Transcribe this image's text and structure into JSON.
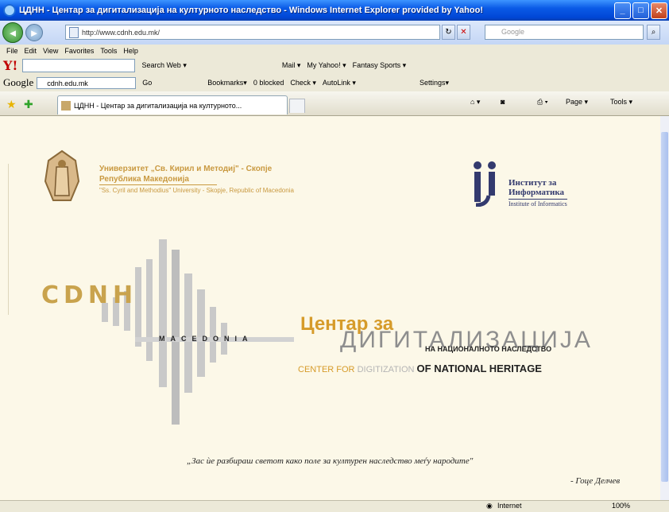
{
  "window": {
    "title": "ЦДНН - Центар за дигитализација на културното наследство - Windows Internet Explorer provided by Yahoo!"
  },
  "address": {
    "url": "http://www.cdnh.edu.mk/"
  },
  "search": {
    "placeholder": "Google"
  },
  "menu": [
    "File",
    "Edit",
    "View",
    "Favorites",
    "Tools",
    "Help"
  ],
  "yahoo_toolbar": {
    "logo": "Y!",
    "search_web": "Search Web ▾",
    "items": [
      "Mail ▾",
      "My Yahoo! ▾",
      "Fantasy Sports ▾"
    ]
  },
  "google_toolbar": {
    "logo": "Google",
    "query": "cdnh.edu.mk",
    "go": "Go",
    "items": [
      "Bookmarks▾",
      "0 blocked",
      "Check ▾",
      "AutoLink ▾",
      "Settings▾"
    ]
  },
  "tab": {
    "title": "ЦДНН - Центар за дигитализација на културното..."
  },
  "commands": {
    "page": "Page ▾",
    "tools": "Tools ▾"
  },
  "page": {
    "uni_mk_line1": "Универзитет „Св. Кирил и Методиј\" - Скопје",
    "uni_mk_line2": "Република Македонија",
    "uni_en": "\"Ss. Cyril and Methodius\" University - Skopje, Republic of Macedonia",
    "inst_line1": "Институт за",
    "inst_line2": "Информатика",
    "inst_en": "Institute of Informatics",
    "cdnh": "CDNH",
    "macedonia": "MACEDONIA",
    "centar": "Центар за",
    "digitalizacija": "ДИГИТАЛИЗАЦИЈА",
    "nac": "НА НАЦИОНАЛНОТО НАСЛЕДСТВО",
    "center_en_a": "CENTER FOR",
    "center_en_b": "DIGITIZATION",
    "center_en_c": "OF NATIONAL HERITAGE",
    "quote": "„Зас ѝе разбираш светот како поле за културен наследство меѓу народите\"",
    "author": "- Гоце Делчев"
  },
  "status": {
    "zone": "Internet",
    "zoom": "100%"
  },
  "colors": {
    "gold": "#c9a34d",
    "orange": "#d69b2a",
    "grey": "#b5b5b5",
    "navy": "#333a6e"
  }
}
